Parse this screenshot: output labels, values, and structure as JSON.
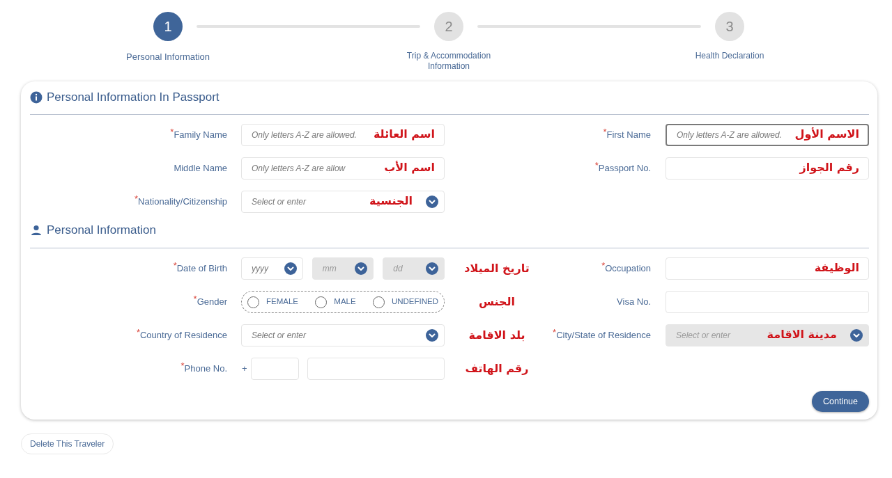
{
  "steps": [
    {
      "number": "1",
      "label": "Personal Information",
      "selected": true
    },
    {
      "number": "2",
      "label": "Trip & Accommodation Information",
      "selected": false
    },
    {
      "number": "3",
      "label": "Health Declaration",
      "selected": false
    }
  ],
  "sections": [
    {
      "title": "Personal Information In Passport",
      "rows": [
        {
          "left": {
            "label": "$^{*}$Family Name",
            "kind": "text",
            "placeholder": "Only letters A-Z are allowed.",
            "focused": false,
            "note": {
              "text": "اسم العائلة",
              "kind": "overlay"
            }
          },
          "right": {
            "label": "$^{*}$First Name",
            "kind": "text",
            "placeholder": "Only letters A-Z are allowed.",
            "focused": true,
            "note": {
              "text": "الاسم الأول",
              "kind": "overlay"
            }
          }
        },
        {
          "left": {
            "label": "Middle Name",
            "kind": "text",
            "placeholder": "Only letters A-Z are allow",
            "focused": false,
            "note": {
              "text": "اسم الأب",
              "kind": "overlay"
            }
          },
          "right": {
            "label": "$^{*}$Passport No.",
            "kind": "text",
            "focused": false,
            "note": {
              "text": "رقم الجواز",
              "kind": "overlay"
            }
          }
        },
        {
          "left": {
            "label": "$^{*}$Nationality/Citizenship",
            "kind": "select",
            "placeholder": "Select or enter",
            "disabled": false,
            "note": {
              "text": "الجنسية",
              "kind": "overlay"
            }
          }
        }
      ]
    },
    {
      "title": "Personal Information",
      "rows": [
        {
          "left": {
            "label": "$^{*}$Date of Birth",
            "kind": "date",
            "parts": [
              {
                "placeholder": "yyyy",
                "disabled": false
              },
              {
                "placeholder": "mm",
                "disabled": true
              },
              {
                "placeholder": "dd",
                "disabled": true
              }
            ],
            "note": {
              "text": "تاريخ الميلاد",
              "kind": "margin"
            }
          },
          "right": {
            "label": "$^{*}$Occupation",
            "kind": "text",
            "focused": false,
            "note": {
              "text": "الوظيفة",
              "kind": "overlay"
            }
          }
        },
        {
          "left": {
            "label": "$^{*}$Gender",
            "kind": "radio",
            "options": [
              {
                "label": "FEMALE",
                "selected": false
              },
              {
                "label": "MALE",
                "selected": false
              },
              {
                "label": "UNDEFINED",
                "selected": false
              }
            ],
            "note": {
              "text": "الجنس",
              "kind": "margin"
            }
          },
          "right": {
            "label": "Visa No.",
            "kind": "text",
            "focused": false
          }
        },
        {
          "left": {
            "label": "$^{*}$Country of Residence",
            "kind": "select",
            "placeholder": "Select or enter",
            "disabled": false,
            "note": {
              "text": "بلد الاقامة",
              "kind": "margin"
            }
          },
          "right": {
            "label": "$^{*}$City/State of Residence",
            "kind": "select",
            "placeholder": "Select or enter",
            "disabled": true,
            "note": {
              "text": "مدينة الاقامة",
              "kind": "overlay"
            }
          }
        },
        {
          "left": {
            "label": "$^{*}$Phone No.",
            "kind": "phone",
            "prefix": "+",
            "note": {
              "text": "رقم الهاتف",
              "kind": "margin"
            }
          }
        }
      ]
    }
  ],
  "continue_button": "Continue",
  "delete_button": "Delete This Traveler"
}
